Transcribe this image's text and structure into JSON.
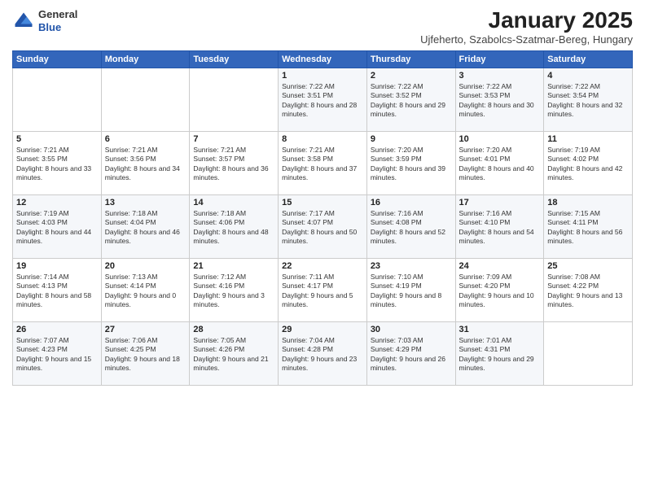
{
  "logo": {
    "general": "General",
    "blue": "Blue"
  },
  "title": "January 2025",
  "subtitle": "Ujfeherto, Szabolcs-Szatmar-Bereg, Hungary",
  "days_of_week": [
    "Sunday",
    "Monday",
    "Tuesday",
    "Wednesday",
    "Thursday",
    "Friday",
    "Saturday"
  ],
  "weeks": [
    [
      {
        "day": "",
        "info": ""
      },
      {
        "day": "",
        "info": ""
      },
      {
        "day": "",
        "info": ""
      },
      {
        "day": "1",
        "info": "Sunrise: 7:22 AM\nSunset: 3:51 PM\nDaylight: 8 hours and 28 minutes."
      },
      {
        "day": "2",
        "info": "Sunrise: 7:22 AM\nSunset: 3:52 PM\nDaylight: 8 hours and 29 minutes."
      },
      {
        "day": "3",
        "info": "Sunrise: 7:22 AM\nSunset: 3:53 PM\nDaylight: 8 hours and 30 minutes."
      },
      {
        "day": "4",
        "info": "Sunrise: 7:22 AM\nSunset: 3:54 PM\nDaylight: 8 hours and 32 minutes."
      }
    ],
    [
      {
        "day": "5",
        "info": "Sunrise: 7:21 AM\nSunset: 3:55 PM\nDaylight: 8 hours and 33 minutes."
      },
      {
        "day": "6",
        "info": "Sunrise: 7:21 AM\nSunset: 3:56 PM\nDaylight: 8 hours and 34 minutes."
      },
      {
        "day": "7",
        "info": "Sunrise: 7:21 AM\nSunset: 3:57 PM\nDaylight: 8 hours and 36 minutes."
      },
      {
        "day": "8",
        "info": "Sunrise: 7:21 AM\nSunset: 3:58 PM\nDaylight: 8 hours and 37 minutes."
      },
      {
        "day": "9",
        "info": "Sunrise: 7:20 AM\nSunset: 3:59 PM\nDaylight: 8 hours and 39 minutes."
      },
      {
        "day": "10",
        "info": "Sunrise: 7:20 AM\nSunset: 4:01 PM\nDaylight: 8 hours and 40 minutes."
      },
      {
        "day": "11",
        "info": "Sunrise: 7:19 AM\nSunset: 4:02 PM\nDaylight: 8 hours and 42 minutes."
      }
    ],
    [
      {
        "day": "12",
        "info": "Sunrise: 7:19 AM\nSunset: 4:03 PM\nDaylight: 8 hours and 44 minutes."
      },
      {
        "day": "13",
        "info": "Sunrise: 7:18 AM\nSunset: 4:04 PM\nDaylight: 8 hours and 46 minutes."
      },
      {
        "day": "14",
        "info": "Sunrise: 7:18 AM\nSunset: 4:06 PM\nDaylight: 8 hours and 48 minutes."
      },
      {
        "day": "15",
        "info": "Sunrise: 7:17 AM\nSunset: 4:07 PM\nDaylight: 8 hours and 50 minutes."
      },
      {
        "day": "16",
        "info": "Sunrise: 7:16 AM\nSunset: 4:08 PM\nDaylight: 8 hours and 52 minutes."
      },
      {
        "day": "17",
        "info": "Sunrise: 7:16 AM\nSunset: 4:10 PM\nDaylight: 8 hours and 54 minutes."
      },
      {
        "day": "18",
        "info": "Sunrise: 7:15 AM\nSunset: 4:11 PM\nDaylight: 8 hours and 56 minutes."
      }
    ],
    [
      {
        "day": "19",
        "info": "Sunrise: 7:14 AM\nSunset: 4:13 PM\nDaylight: 8 hours and 58 minutes."
      },
      {
        "day": "20",
        "info": "Sunrise: 7:13 AM\nSunset: 4:14 PM\nDaylight: 9 hours and 0 minutes."
      },
      {
        "day": "21",
        "info": "Sunrise: 7:12 AM\nSunset: 4:16 PM\nDaylight: 9 hours and 3 minutes."
      },
      {
        "day": "22",
        "info": "Sunrise: 7:11 AM\nSunset: 4:17 PM\nDaylight: 9 hours and 5 minutes."
      },
      {
        "day": "23",
        "info": "Sunrise: 7:10 AM\nSunset: 4:19 PM\nDaylight: 9 hours and 8 minutes."
      },
      {
        "day": "24",
        "info": "Sunrise: 7:09 AM\nSunset: 4:20 PM\nDaylight: 9 hours and 10 minutes."
      },
      {
        "day": "25",
        "info": "Sunrise: 7:08 AM\nSunset: 4:22 PM\nDaylight: 9 hours and 13 minutes."
      }
    ],
    [
      {
        "day": "26",
        "info": "Sunrise: 7:07 AM\nSunset: 4:23 PM\nDaylight: 9 hours and 15 minutes."
      },
      {
        "day": "27",
        "info": "Sunrise: 7:06 AM\nSunset: 4:25 PM\nDaylight: 9 hours and 18 minutes."
      },
      {
        "day": "28",
        "info": "Sunrise: 7:05 AM\nSunset: 4:26 PM\nDaylight: 9 hours and 21 minutes."
      },
      {
        "day": "29",
        "info": "Sunrise: 7:04 AM\nSunset: 4:28 PM\nDaylight: 9 hours and 23 minutes."
      },
      {
        "day": "30",
        "info": "Sunrise: 7:03 AM\nSunset: 4:29 PM\nDaylight: 9 hours and 26 minutes."
      },
      {
        "day": "31",
        "info": "Sunrise: 7:01 AM\nSunset: 4:31 PM\nDaylight: 9 hours and 29 minutes."
      },
      {
        "day": "",
        "info": ""
      }
    ]
  ]
}
